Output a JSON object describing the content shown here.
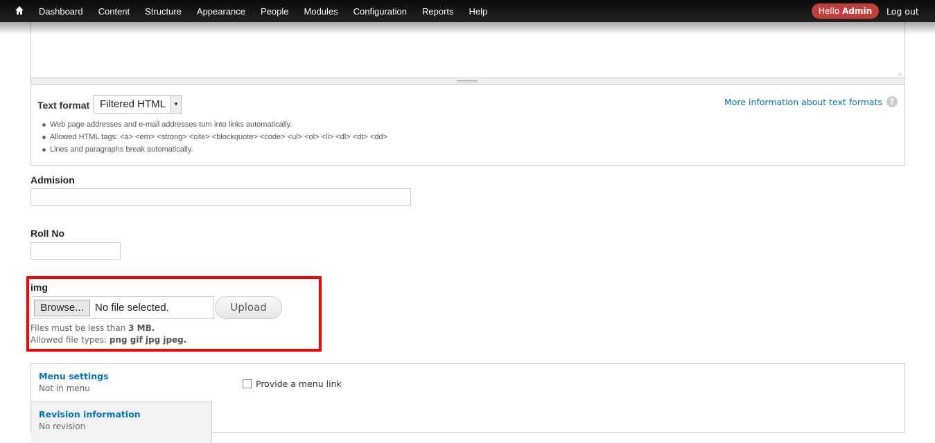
{
  "toolbar": {
    "items": [
      "Dashboard",
      "Content",
      "Structure",
      "Appearance",
      "People",
      "Modules",
      "Configuration",
      "Reports",
      "Help"
    ],
    "hello": "Hello",
    "user": "Admin",
    "logout": "Log out"
  },
  "format": {
    "label": "Text format",
    "selected": "Filtered HTML",
    "more": "More information about text formats",
    "tips": [
      "Web page addresses and e-mail addresses turn into links automatically.",
      "Allowed HTML tags: <a> <em> <strong> <cite> <blockquote> <code> <ul> <ol> <li> <dl> <dt> <dd>",
      "Lines and paragraphs break automatically."
    ]
  },
  "fields": {
    "admision": {
      "label": "Admision",
      "value": ""
    },
    "roll": {
      "label": "Roll No",
      "value": ""
    }
  },
  "img": {
    "label": "img",
    "browse": "Browse...",
    "nofile": "No file selected.",
    "upload": "Upload",
    "size_prefix": "Files must be less than ",
    "size": "3 MB.",
    "types_prefix": "Allowed file types: ",
    "types": "png gif jpg jpeg."
  },
  "vtabs": {
    "menu_title": "Menu settings",
    "menu_summary": "Not in menu",
    "rev_title": "Revision information",
    "rev_summary": "No revision",
    "menu_checkbox": "Provide a menu link"
  },
  "colors": {
    "accent": "#0074bd",
    "highlight": "#ff0000",
    "hello_bg": "#c0403f"
  }
}
